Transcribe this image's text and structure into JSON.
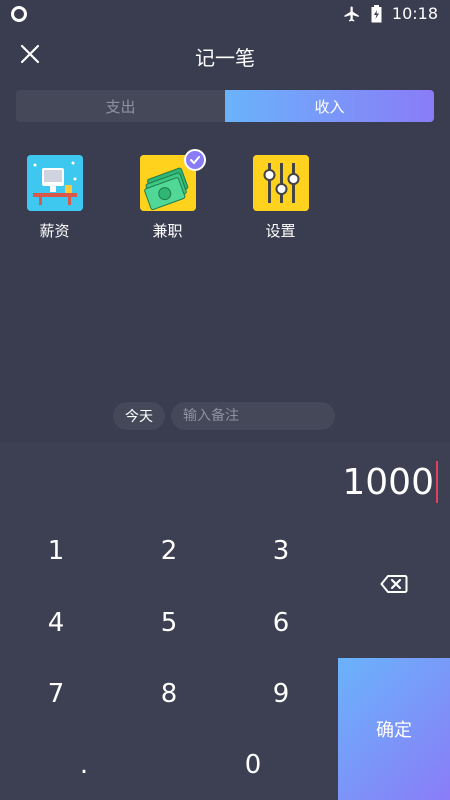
{
  "status": {
    "time": "10:18"
  },
  "header": {
    "title": "记一笔"
  },
  "tabs": [
    {
      "label": "支出"
    },
    {
      "label": "收入"
    }
  ],
  "categories": [
    {
      "label": "薪资",
      "icon": "salary-icon"
    },
    {
      "label": "兼职",
      "icon": "part-time-icon",
      "selected": true
    },
    {
      "label": "设置",
      "icon": "settings-icon"
    }
  ],
  "note": {
    "date_label": "今天",
    "placeholder": "输入备注"
  },
  "amount": "1000",
  "keypad": {
    "keys": [
      "1",
      "2",
      "3",
      "4",
      "5",
      "6",
      "7",
      "8",
      "9",
      ".",
      "0"
    ],
    "confirm_label": "确定"
  },
  "colors": {
    "accent_start": "#6ab3fb",
    "accent_end": "#8a7cf7",
    "background": "#3a3c4f"
  }
}
